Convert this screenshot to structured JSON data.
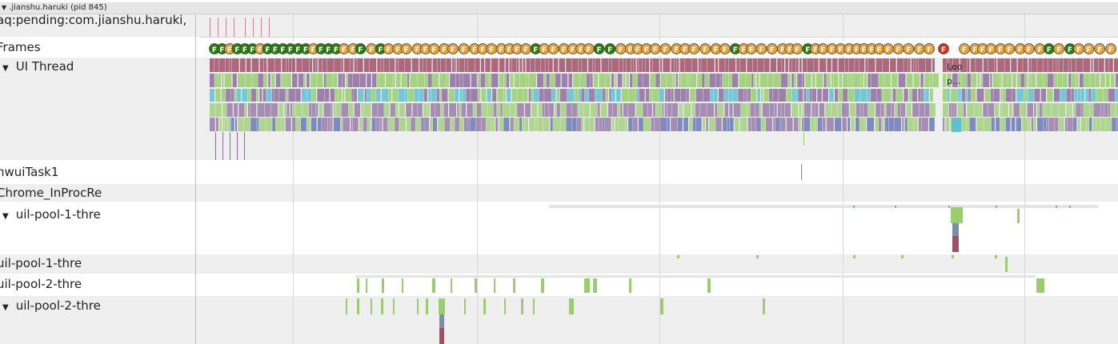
{
  "process_header": {
    "title": ".jianshu.haruki (pid 845)",
    "collapsed": false
  },
  "tracks": [
    {
      "id": "counter",
      "label": "aq:pending:com.jianshu.haruki,",
      "expandable": false
    },
    {
      "id": "frames",
      "label": "Frames",
      "expandable": false
    },
    {
      "id": "ui-thread",
      "label": "UI Thread",
      "expandable": true,
      "expanded": true
    },
    {
      "id": "hwui-task",
      "label": "hwuiTask1",
      "expandable": false
    },
    {
      "id": "chrome-inproc",
      "label": "Chrome_InProcRe",
      "expandable": false
    },
    {
      "id": "uil-pool-1-a",
      "label": "uil-pool-1-thre",
      "expandable": true,
      "expanded": true
    },
    {
      "id": "uil-pool-1-b",
      "label": "uil-pool-1-thre",
      "expandable": false
    },
    {
      "id": "uil-pool-2-a",
      "label": "uil-pool-2-thre",
      "expandable": false
    },
    {
      "id": "uil-pool-2-b",
      "label": "uil-pool-2-thre",
      "expandable": true,
      "expanded": true
    }
  ],
  "frame_marker_letter": "F",
  "slice_labels": {
    "loop_line1": "Loo",
    "loop_line2": "p..."
  },
  "colors": {
    "frame_good": "#2a7d10",
    "frame_jank": "#e2a13a",
    "frame_bad": "#d7301f",
    "slice_red": "#a05068",
    "slice_green": "#98cd70",
    "slice_purple": "#8e6ca0",
    "slice_cyan": "#5fc0d0",
    "slice_blue": "#5a6ab0",
    "grid": "#d8d8d8"
  }
}
